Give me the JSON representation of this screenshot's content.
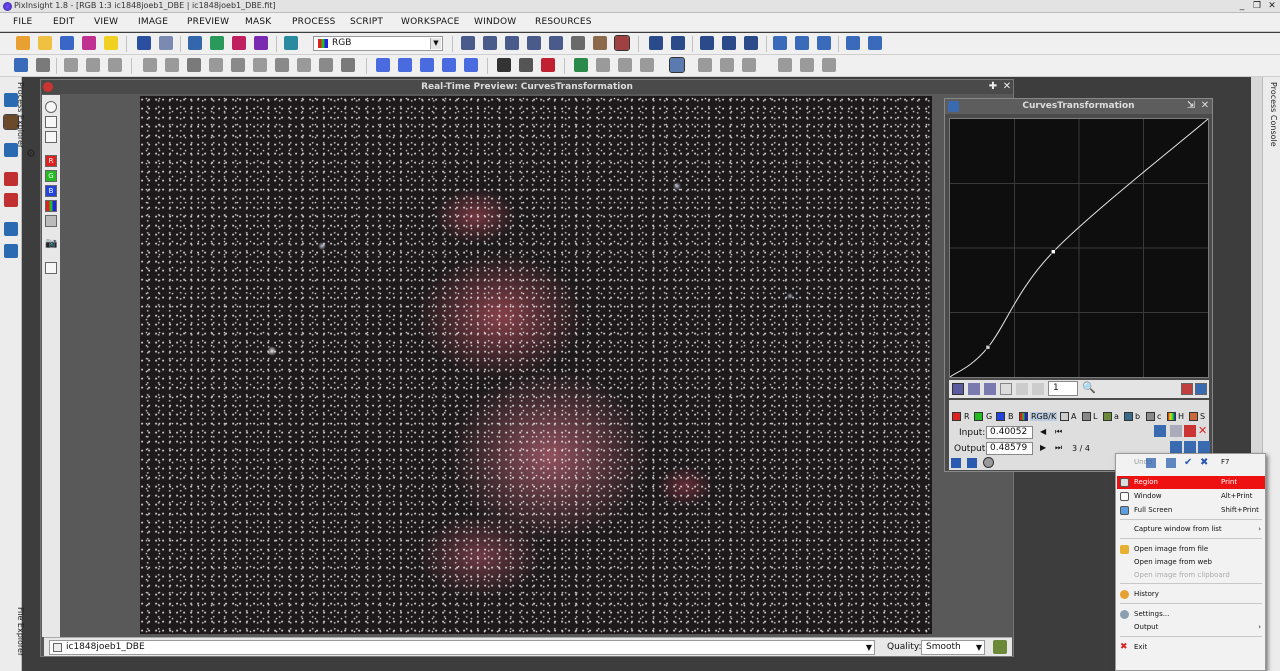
{
  "window": {
    "title": "PixInsight 1.8 - [RGB 1:3 ic1848joeb1_DBE | ic1848joeb1_DBE.fit]",
    "min_glyph": "_",
    "max_glyph": "❐",
    "close_glyph": "✕"
  },
  "menubar": {
    "items": [
      "FILE",
      "EDIT",
      "VIEW",
      "IMAGE",
      "PREVIEW",
      "MASK",
      "PROCESS",
      "SCRIPT",
      "WORKSPACE",
      "WINDOW",
      "RESOURCES"
    ]
  },
  "toolbar": {
    "channel_select": "RGB"
  },
  "left_strip": {
    "process_explorer": "Process Explorer",
    "file_explorer": "File Explorer"
  },
  "right_strip": {
    "process_console": "Process Console"
  },
  "image_window": {
    "title": "Real-Time Preview: CurvesTransformation",
    "view_id": "ic1848joeb1_DBE",
    "quality_label": "Quality:",
    "quality_value": "Smooth",
    "channel_buttons": [
      "R",
      "G",
      "B"
    ]
  },
  "curves": {
    "title": "CurvesTransformation",
    "zoom": "1",
    "channels": [
      "R",
      "G",
      "B",
      "RGB/K",
      "A",
      "L",
      "a",
      "b",
      "c",
      "H",
      "S"
    ],
    "input_label": "Input:",
    "input_value": "0.40052",
    "output_label": "Output:",
    "output_value": "0.48579",
    "point_index": "3 / 4",
    "curve_points": [
      [
        0,
        0
      ],
      [
        0.147,
        0.115
      ],
      [
        0.40052,
        0.48579
      ],
      [
        1,
        1
      ]
    ]
  },
  "context_menu": {
    "items": [
      {
        "label": "Undo",
        "shortcut": "F7",
        "icon": "undo-icon",
        "state": "partial"
      },
      {
        "label": "Region",
        "shortcut": "Print",
        "icon": "region-icon",
        "state": "selected"
      },
      {
        "label": "Window",
        "shortcut": "Alt+Print",
        "icon": "window-icon",
        "state": "normal"
      },
      {
        "label": "Full Screen",
        "shortcut": "Shift+Print",
        "icon": "fullscreen-icon",
        "state": "normal"
      },
      {
        "label": "Capture window from list",
        "shortcut": "",
        "icon": "",
        "state": "submenu"
      },
      {
        "label": "Open image from file",
        "shortcut": "",
        "icon": "folder-icon",
        "state": "normal"
      },
      {
        "label": "Open image from web",
        "shortcut": "",
        "icon": "",
        "state": "normal"
      },
      {
        "label": "Open image from clipboard",
        "shortcut": "",
        "icon": "",
        "state": "disabled"
      },
      {
        "label": "History",
        "shortcut": "",
        "icon": "history-icon",
        "state": "normal"
      },
      {
        "label": "Settings...",
        "shortcut": "",
        "icon": "settings-icon",
        "state": "normal"
      },
      {
        "label": "Output",
        "shortcut": "",
        "icon": "",
        "state": "submenu"
      },
      {
        "label": "Exit",
        "shortcut": "",
        "icon": "exit-icon",
        "state": "normal"
      }
    ]
  },
  "colors": {
    "accent_selected": "#ee1111",
    "red": "#dd2222",
    "green": "#22bb22",
    "blue": "#2244dd"
  }
}
